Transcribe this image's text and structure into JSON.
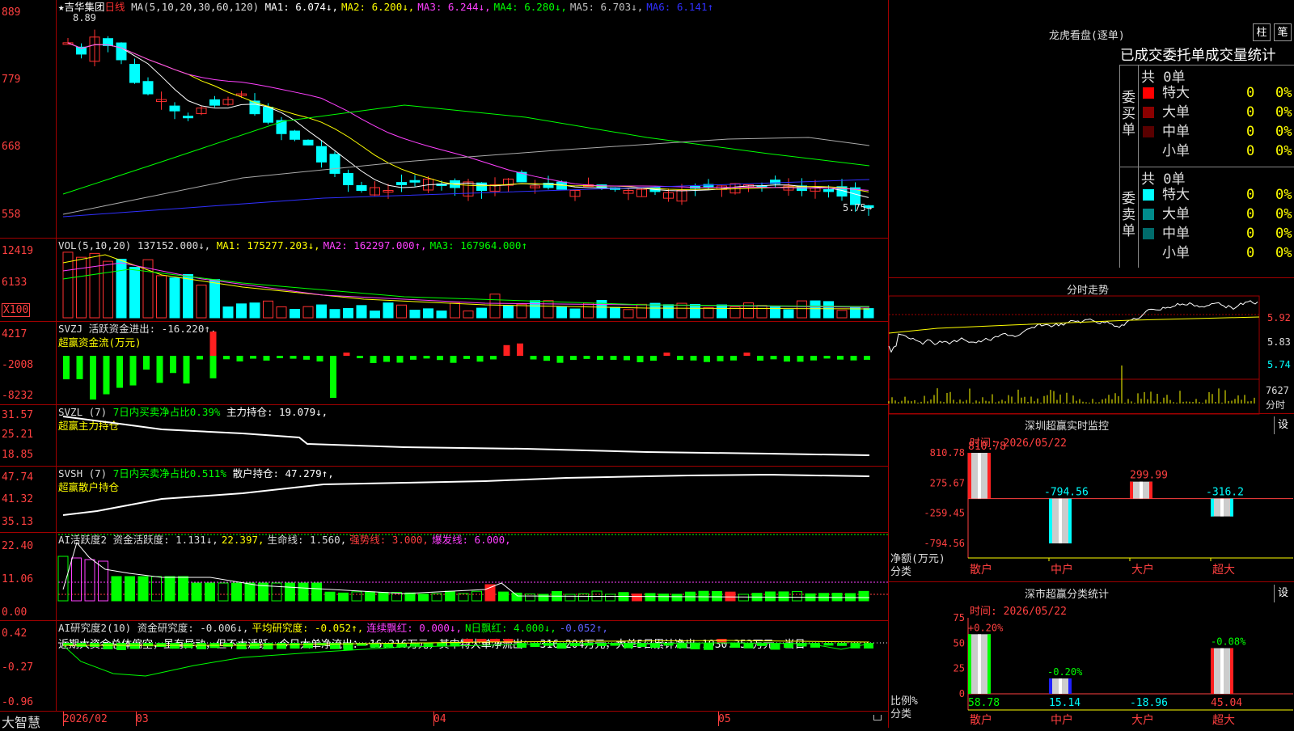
{
  "main": {
    "title": "★吉华集团",
    "period": "日线",
    "ma_def": "MA(5,10,20,30,60,120)",
    "ma": [
      {
        "label": "MA1: 6.074↓,",
        "color": "#ffffff"
      },
      {
        "label": "MA2: 6.200↓,",
        "color": "#ffff00"
      },
      {
        "label": "MA3: 6.244↓,",
        "color": "#ff40ff"
      },
      {
        "label": "MA4: 6.280↓,",
        "color": "#00ff00"
      },
      {
        "label": "MA5: 6.703↓,",
        "color": "#c0c0c0"
      },
      {
        "label": "MA6: 6.141↑",
        "color": "#3030ff"
      }
    ],
    "ticks": [
      "889",
      "779",
      "668",
      "558"
    ],
    "high_label": "8.89",
    "low_label": "5.75→"
  },
  "vol": {
    "title": "VOL(5,10,20)",
    "value": "137152.000↓,",
    "ma": [
      {
        "label": "MA1: 175277.203↓,",
        "color": "#ffff00"
      },
      {
        "label": "MA2: 162297.000↑,",
        "color": "#ff40ff"
      },
      {
        "label": "MA3: 167964.000↑",
        "color": "#00ff00"
      }
    ],
    "ticks": [
      "12419",
      "6133"
    ],
    "unit": "X100"
  },
  "svzj": {
    "title": "SVZJ  活跃资金进出: -16.220↑,",
    "sub": "超赢资金流(万元)",
    "ticks": [
      "4217",
      "-2008",
      "-8232"
    ]
  },
  "svzl": {
    "title": "SVZL (7)",
    "a": "7日内买卖净占比0.39%",
    "b": "主力持仓: 19.079↓,",
    "sub": "超赢主力持仓",
    "ticks": [
      "31.57",
      "25.21",
      "18.85"
    ]
  },
  "svsh": {
    "title": "SVSH (7)",
    "a": "7日内买卖净占比0.511%",
    "b": "散户持仓: 47.279↑,",
    "sub": "超赢散户持仓",
    "ticks": [
      "47.74",
      "41.32",
      "35.13"
    ]
  },
  "ai": {
    "parts": [
      {
        "t": "AI活跃度2 资金活跃度: 1.131↓,",
        "c": "#dddddd"
      },
      {
        "t": "22.397,",
        "c": "#ffff00"
      },
      {
        "t": "生命线: 1.560,",
        "c": "#dddddd"
      },
      {
        "t": "强势线: 3.000,",
        "c": "#ff4040"
      },
      {
        "t": "爆发线: 6.000,",
        "c": "#ff40ff"
      }
    ],
    "ticks": [
      "22.40",
      "11.06",
      "0.00"
    ]
  },
  "ai2": {
    "parts": [
      {
        "t": "AI研究度2(10) 资金研究度: -0.006↓,",
        "c": "#dddddd"
      },
      {
        "t": "平均研究度: -0.052↑,",
        "c": "#ffff00"
      },
      {
        "t": "连续飘红: 0.000↓,",
        "c": "#ff40ff"
      },
      {
        "t": "N日飘红: 4.000↓,",
        "c": "#00ff00"
      },
      {
        "t": "-0.052↑,",
        "c": "#6060ff"
      }
    ],
    "note": "近期大资金总体偏空，虽有异动，但不太活跃，今日大单净流出：-16.216万元，其中特大单净流出：-316.204万元，大单5日累计净出-1930.352万元，当日",
    "ticks": [
      "0.42",
      "-0.27",
      "-0.96"
    ]
  },
  "bottom": {
    "brand": "大智慧",
    "dates": [
      "2026/02",
      "03",
      "04",
      "05"
    ]
  },
  "lhb": {
    "title": "龙虎看盘(逐单)",
    "btn_a": "柱",
    "btn_b": "笔",
    "subtitle": "已成交委托单成交量统计",
    "buy_side": "委买单",
    "sell_side": "委卖单",
    "buy_total": "共 0单",
    "sell_total": "共 0单",
    "buy_rows": [
      {
        "label": "特大",
        "n": "0",
        "p": "0%",
        "color": "#ff0000"
      },
      {
        "label": "大单",
        "n": "0",
        "p": "0%",
        "color": "#8b0000"
      },
      {
        "label": "中单",
        "n": "0",
        "p": "0%",
        "color": "#5a0000"
      },
      {
        "label": "小单",
        "n": "0",
        "p": "0%",
        "color": "#000000"
      }
    ],
    "sell_rows": [
      {
        "label": "特大",
        "n": "0",
        "p": "0%",
        "color": "#00ffff"
      },
      {
        "label": "大单",
        "n": "0",
        "p": "0%",
        "color": "#008b8b"
      },
      {
        "label": "中单",
        "n": "0",
        "p": "0%",
        "color": "#006b6b"
      },
      {
        "label": "小单",
        "n": "0",
        "p": "0%",
        "color": "#000000"
      }
    ]
  },
  "fenshi": {
    "title": "分时走势",
    "ticks": [
      "5.92",
      "5.83",
      "5.74"
    ],
    "vol_tick": "7627",
    "vol_label": "分时"
  },
  "monitor": {
    "title": "深圳超赢实时监控",
    "btn": "设",
    "time": "时间: 2026/05/22",
    "ticks": [
      "810.78",
      "275.67",
      "-259.45",
      "-794.56"
    ],
    "ylabel": "净额(万元)",
    "xlabel": "分类",
    "cats": [
      "散户",
      "中户",
      "大户",
      "超大"
    ],
    "values": [
      810.78,
      -794.56,
      299.99,
      -316.2
    ],
    "value_labels": [
      "810.78",
      "-794.56",
      "299.99",
      "-316.2"
    ]
  },
  "classify": {
    "title": "深市超赢分类统计",
    "btn": "设",
    "time": "时间: 2026/05/22",
    "ticks": [
      "75",
      "50",
      "25",
      "0"
    ],
    "ylabel": "比例%",
    "xlabel": "分类",
    "cats": [
      "散户",
      "中户",
      "大户",
      "超大"
    ],
    "values": [
      58.78,
      15.14,
      -18.96,
      45.04
    ],
    "chg": [
      "+0.20%",
      "-0.20%",
      "",
      "-0.08%"
    ],
    "value_labels": [
      "58.78",
      "15.14",
      "-18.96",
      "45.04"
    ]
  }
}
